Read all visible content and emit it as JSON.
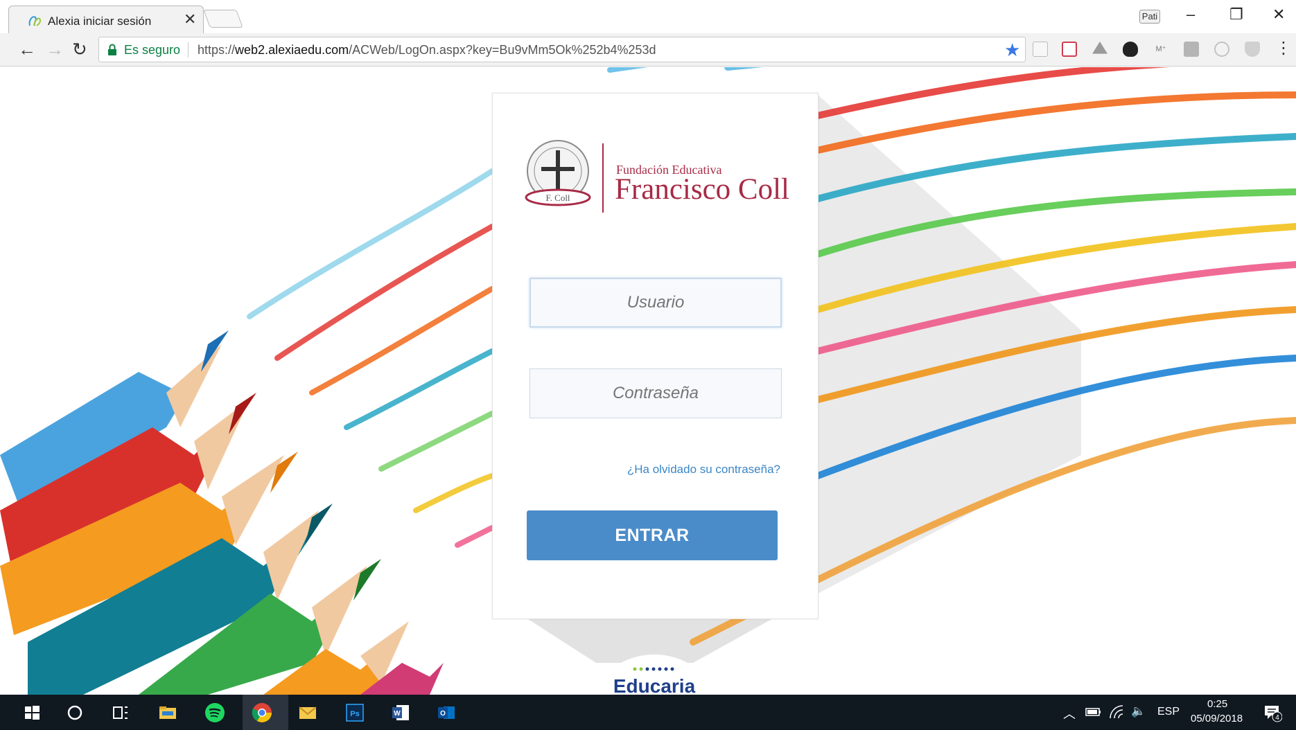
{
  "browser": {
    "tab_title": "Alexia iniciar sesión",
    "tab_close": "✕",
    "profile_label": "Pati",
    "window_controls": {
      "minimize": "–",
      "restore": "❐",
      "close": "✕"
    },
    "nav": {
      "back": "←",
      "forward": "→",
      "reload": "↻"
    },
    "security_label": "Es seguro",
    "url_scheme": "https://",
    "url_host": "web2.alexiaedu.com",
    "url_path": "/ACWeb/LogOn.aspx?key=Bu9vMm5Ok%252b4%253d",
    "bookmark_icon": "★",
    "extensions": [
      "page-icon",
      "pocket-icon",
      "drive-icon",
      "owl-icon",
      "mega-icon",
      "pdf-icon",
      "circle-icon",
      "shield-icon"
    ],
    "menu_icon": "⋮"
  },
  "login": {
    "logo_subtitle": "Fundación Educativa",
    "logo_title": "Francisco Coll",
    "seal_text": "F. Coll",
    "user_placeholder": "Usuario",
    "password_placeholder": "Contraseña",
    "forgot_link": "¿Ha olvidado su contraseña?",
    "submit_label": "ENTRAR"
  },
  "footer_brand": "Educaria",
  "taskbar": {
    "language": "ESP",
    "time": "0:25",
    "date": "05/09/2018",
    "notifications": "4",
    "apps": [
      "start-icon",
      "cortana-icon",
      "task-view-icon",
      "file-explorer-icon",
      "spotify-icon",
      "chrome-icon",
      "mail-icon",
      "photoshop-icon",
      "word-icon",
      "outlook-icon"
    ]
  },
  "colors": {
    "brand_maroon": "#a72a46",
    "button_blue": "#4a8cc9",
    "link_blue": "#3b86c6",
    "secure_green": "#0b8043",
    "taskbar_bg": "#101820"
  }
}
